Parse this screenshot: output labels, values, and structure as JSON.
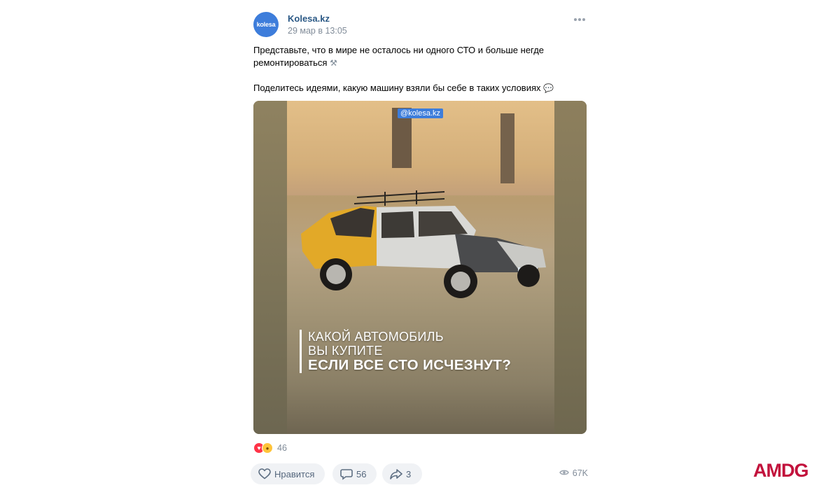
{
  "post": {
    "author": "Kolesa.kz",
    "avatar_text": "kolesa",
    "date": "29 мар в 13:05",
    "text_line1": "Представьте, что в мире не осталось ни одного СТО и больше негде ремонтироваться",
    "text_line1_emoji": "⚒",
    "text_line2": "Поделитесь идеями, какую машину взяли бы себе в таких условиях",
    "text_line2_emoji": "💬",
    "image": {
      "watermark": "@kolesa.kz",
      "caption_line1": "КАКОЙ АВТОМОБИЛЬ",
      "caption_line2": "ВЫ КУПИТЕ",
      "caption_line3": "ЕСЛИ ВСЕ СТО ИСЧЕЗНУТ?"
    },
    "reactions": {
      "icons": [
        "heart-icon",
        "sad-icon"
      ],
      "count": "46"
    },
    "actions": {
      "like_label": "Нравится",
      "comments_count": "56",
      "shares_count": "3",
      "views_count": "67K"
    }
  },
  "brand_logo": "AMDG",
  "colors": {
    "link": "#2a5885",
    "avatar": "#3d7ddb",
    "muted": "#818c99",
    "button_bg": "#f0f2f5",
    "logo": "#c2123c"
  }
}
